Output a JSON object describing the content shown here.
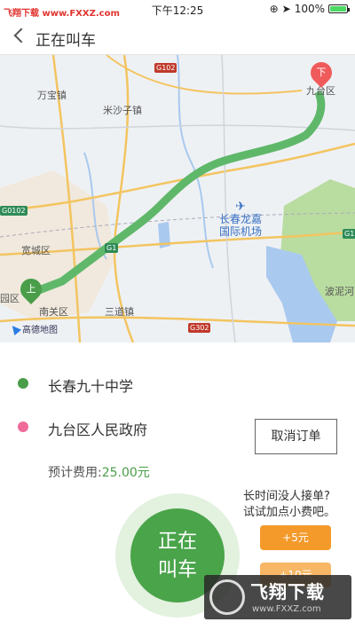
{
  "status_bar": {
    "watermark": "飞翔下载 www.FXXZ.com",
    "time": "下午12:25",
    "battery": "100%"
  },
  "nav": {
    "title": "正在叫车"
  },
  "map": {
    "labels": [
      "万宝镇",
      "米沙子镇",
      "九台区",
      "宽城区",
      "南关区",
      "三道镇",
      "园区",
      "波泥河"
    ],
    "airport": [
      "长春龙嘉",
      "国际机场"
    ],
    "roads": [
      "G102",
      "G0102",
      "G1",
      "G302",
      "G1"
    ],
    "start_pin": "上",
    "end_pin": "下",
    "provider": "高德地图"
  },
  "trip": {
    "pickup": "长春九十中学",
    "dropoff": "九台区人民政府",
    "fee_label": "预计费用:",
    "fee_value": "25.00元",
    "cancel_button": "取消订单",
    "calling_line1": "正在",
    "calling_line2": "叫车",
    "tip_line1": "长时间没人接单?",
    "tip_line2": "试试加点小费吧。",
    "tip_options": [
      "+5元",
      "+10元"
    ]
  },
  "watermark_logo": {
    "title": "飞翔下载",
    "url": "www.FXXZ.com"
  },
  "colors": {
    "accent_green": "#4aa44a",
    "route": "#5fb86a",
    "tip_orange": "#f39a2b",
    "pink": "#f06a9a"
  }
}
